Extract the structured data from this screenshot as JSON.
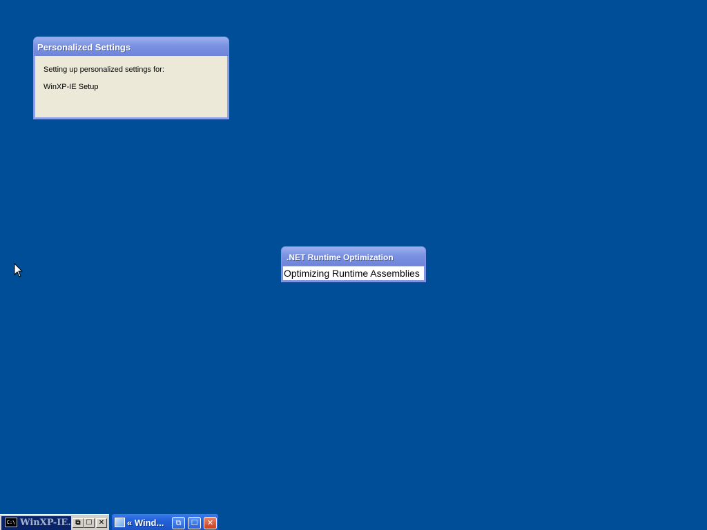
{
  "desktop": {
    "background_color": "#004e98"
  },
  "personalized_settings": {
    "title": "Personalized Settings",
    "line1": "Setting up personalized settings for:",
    "line2": "WinXP-IE Setup"
  },
  "net_optimization": {
    "title": ".NET Runtime Optimization",
    "status": "Optimizing Runtime Assemblies"
  },
  "taskbar": {
    "task_cmd": {
      "icon": "command-prompt-icon",
      "icon_text": "C:\\",
      "label": "WinXP-IE...",
      "restore_glyph": "⧉",
      "maximize_glyph": "☐",
      "close_glyph": "✕"
    },
    "task_window": {
      "icon": "window-icon",
      "label": "« Wind...",
      "restore_glyph": "⧉",
      "maximize_glyph": "☐",
      "close_glyph": "✕"
    }
  },
  "cursor": {
    "icon": "arrow-cursor-icon"
  }
}
